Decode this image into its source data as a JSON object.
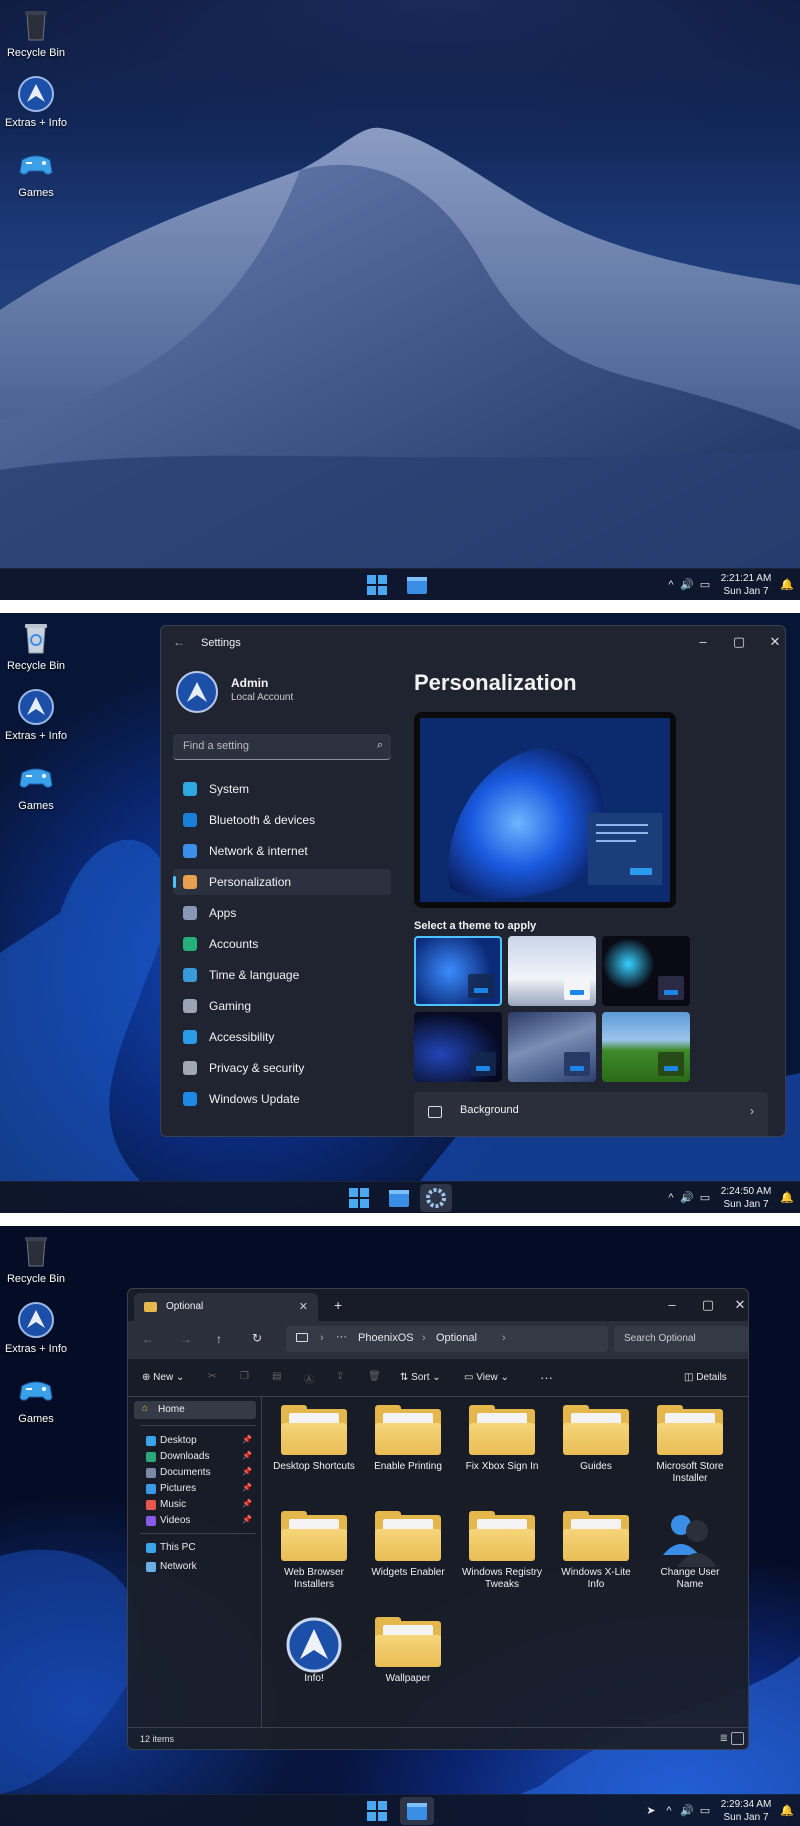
{
  "desktop": {
    "icons": [
      {
        "label": "Recycle Bin",
        "icon": "recycle-bin-icon"
      },
      {
        "label": "Extras + Info",
        "icon": "phoenix-orb-icon"
      },
      {
        "label": "Games",
        "icon": "gamepad-icon"
      }
    ]
  },
  "taskbars": [
    {
      "time": "2:21:21 AM",
      "date": "Sun Jan 7"
    },
    {
      "time": "2:24:50 AM",
      "date": "Sun Jan 7"
    },
    {
      "time": "2:29:34 AM",
      "date": "Sun Jan 7"
    }
  ],
  "settings": {
    "window_title": "Settings",
    "user_name": "Admin",
    "account_type": "Local Account",
    "search_placeholder": "Find a setting",
    "nav": [
      {
        "label": "System",
        "icon": "monitor-icon",
        "color": "#2ea8e0"
      },
      {
        "label": "Bluetooth & devices",
        "icon": "bluetooth-icon",
        "color": "#1a7fd6"
      },
      {
        "label": "Network & internet",
        "icon": "wifi-icon",
        "color": "#3b8fe8"
      },
      {
        "label": "Personalization",
        "icon": "brush-icon",
        "color": "#e8a050"
      },
      {
        "label": "Apps",
        "icon": "apps-icon",
        "color": "#8a98b8"
      },
      {
        "label": "Accounts",
        "icon": "person-icon",
        "color": "#25b07a"
      },
      {
        "label": "Time & language",
        "icon": "globe-clock-icon",
        "color": "#3a9ad8"
      },
      {
        "label": "Gaming",
        "icon": "controller-icon",
        "color": "#9aa4b4"
      },
      {
        "label": "Accessibility",
        "icon": "accessibility-icon",
        "color": "#2a9be8"
      },
      {
        "label": "Privacy & security",
        "icon": "shield-icon",
        "color": "#a0a8b4"
      },
      {
        "label": "Windows Update",
        "icon": "update-icon",
        "color": "#1e88e5"
      }
    ],
    "selected_nav": "Personalization",
    "page_title": "Personalization",
    "theme_heading": "Select a theme to apply",
    "background_row": "Background"
  },
  "explorer": {
    "tab_title": "Optional",
    "breadcrumb": [
      "PhoenixOS",
      "Optional"
    ],
    "search_placeholder": "Search Optional",
    "commands": {
      "new": "New",
      "sort": "Sort",
      "view": "View",
      "details": "Details"
    },
    "sidebar": {
      "home": "Home",
      "quick": [
        "Desktop",
        "Downloads",
        "Documents",
        "Pictures",
        "Music",
        "Videos"
      ],
      "other": [
        "This PC",
        "Network"
      ]
    },
    "items": [
      {
        "label": "Desktop Shortcuts",
        "kind": "folder"
      },
      {
        "label": "Enable Printing",
        "kind": "folder"
      },
      {
        "label": "Fix Xbox Sign In",
        "kind": "folder"
      },
      {
        "label": "Guides",
        "kind": "folder"
      },
      {
        "label": "Microsoft Store Installer",
        "kind": "folder"
      },
      {
        "label": "Web Browser Installers",
        "kind": "folder"
      },
      {
        "label": "Widgets Enabler",
        "kind": "folder"
      },
      {
        "label": "Windows Registry Tweaks",
        "kind": "folder"
      },
      {
        "label": "Windows X-Lite Info",
        "kind": "folder"
      },
      {
        "label": "Change User Name",
        "kind": "user"
      },
      {
        "label": "Info!",
        "kind": "orb"
      },
      {
        "label": "Wallpaper",
        "kind": "folder"
      }
    ],
    "status": "12 items"
  }
}
